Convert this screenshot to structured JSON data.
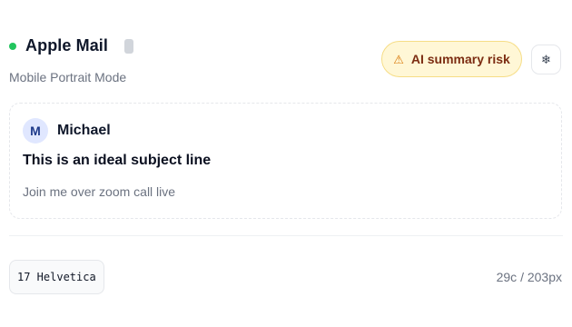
{
  "header": {
    "app_title": "Apple Mail",
    "mode": "Mobile Portrait Mode",
    "status_color": "#22c55e",
    "risk_badge": {
      "icon": "warning-icon",
      "label": "AI summary risk"
    },
    "settings_icon": "snowflake-icon"
  },
  "preview": {
    "avatar_initial": "M",
    "sender": "Michael",
    "subject": "This is an ideal subject line",
    "snippet": "Join me over zoom call live"
  },
  "footer": {
    "font_chip": "17 Helvetica",
    "counts": "29c / 203px"
  }
}
